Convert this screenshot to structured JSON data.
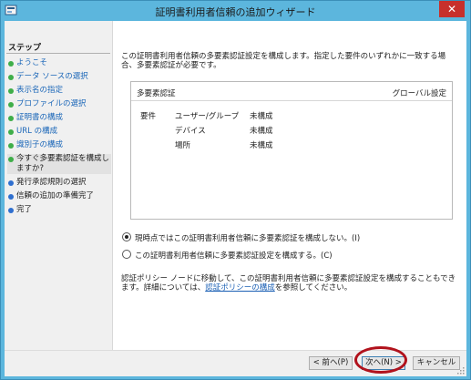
{
  "window": {
    "title": "証明書利用者信頼の追加ウィザード",
    "close_label": "✕"
  },
  "sidebar": {
    "heading": "ステップ",
    "steps": [
      {
        "label": "ようこそ",
        "state": "done"
      },
      {
        "label": "データ ソースの選択",
        "state": "done"
      },
      {
        "label": "表示名の指定",
        "state": "done"
      },
      {
        "label": "プロファイルの選択",
        "state": "done"
      },
      {
        "label": "証明書の構成",
        "state": "done"
      },
      {
        "label": "URL の構成",
        "state": "done"
      },
      {
        "label": "識別子の構成",
        "state": "done"
      },
      {
        "label": "今すぐ多要素認証を構成しますか?",
        "state": "current"
      },
      {
        "label": "発行承認規則の選択",
        "state": "pending"
      },
      {
        "label": "信頼の追加の準備完了",
        "state": "pending"
      },
      {
        "label": "完了",
        "state": "pending"
      }
    ]
  },
  "main": {
    "intro": "この証明書利用者信頼の多要素認証設定を構成します。指定した要件のいずれかに一致する場合、多要素認証が必要です。",
    "settings_box": {
      "title": "多要素認証",
      "global_label": "グローバル設定",
      "requirements_label": "要件",
      "rows": [
        {
          "name": "ユーザー/グループ",
          "value": "未構成"
        },
        {
          "name": "デバイス",
          "value": "未構成"
        },
        {
          "name": "場所",
          "value": "未構成"
        }
      ]
    },
    "options": [
      {
        "label": "現時点ではこの証明書利用者信頼に多要素認証を構成しない。(I)",
        "checked": true
      },
      {
        "label": "この証明書利用者信頼に多要素認証設定を構成する。(C)",
        "checked": false
      }
    ],
    "note_before": "認証ポリシー ノードに移動して、この証明書利用者信頼に多要素認証設定を構成することもできます。詳細については、",
    "note_link": "認証ポリシーの構成",
    "note_after": "を参照してください。"
  },
  "buttons": {
    "back": "< 前へ(P)",
    "next": "次へ(N) >",
    "cancel": "キャンセル"
  },
  "colors": {
    "title_bar": "#5cb6dd",
    "close": "#c7302b",
    "step_done": "#3fae49",
    "step_pending": "#2f6fcf",
    "highlight_ring": "#b1121c"
  }
}
